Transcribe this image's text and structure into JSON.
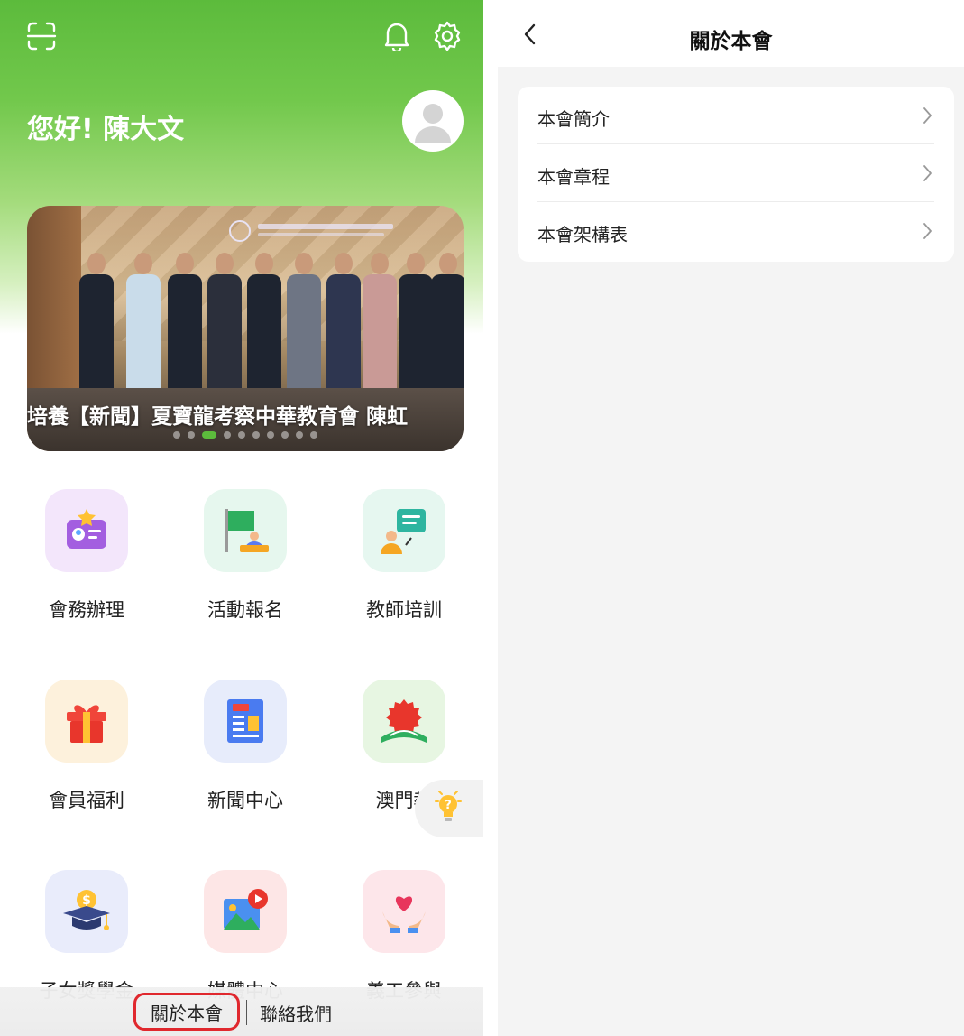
{
  "home": {
    "header": {
      "scan_icon": "scan-icon",
      "bell_icon": "bell-icon",
      "settings_icon": "gear-icon"
    },
    "greeting": "您好! 陳大文",
    "banner": {
      "caption": "培養【新聞】夏寶龍考察中華教育會 陳虹",
      "dots_total": 10,
      "active_dot": 2
    },
    "tiles": [
      {
        "label": "會務辦理",
        "icon": "member-card-icon",
        "bg": "#f3e6fb"
      },
      {
        "label": "活動報名",
        "icon": "flag-icon",
        "bg": "#e6f7ee"
      },
      {
        "label": "教師培訓",
        "icon": "teacher-icon",
        "bg": "#e6f7f0"
      },
      {
        "label": "會員福利",
        "icon": "gift-icon",
        "bg": "#fdf1dc"
      },
      {
        "label": "新聞中心",
        "icon": "news-icon",
        "bg": "#e7ecfb"
      },
      {
        "label": "澳門教",
        "icon": "education-icon",
        "bg": "#e7f6e2"
      },
      {
        "label": "子女獎學金",
        "icon": "scholarship-icon",
        "bg": "#e9ecfb"
      },
      {
        "label": "媒體中心",
        "icon": "media-icon",
        "bg": "#fde6e6"
      },
      {
        "label": "義工參與",
        "icon": "volunteer-icon",
        "bg": "#fde6ea"
      }
    ],
    "bottom_links": {
      "about": "關於本會",
      "contact": "聯絡我們"
    },
    "help_icon": "lightbulb-question-icon"
  },
  "about_page": {
    "title": "關於本會",
    "back_icon": "chevron-left-icon",
    "items": [
      {
        "label": "本會簡介"
      },
      {
        "label": "本會章程"
      },
      {
        "label": "本會架構表"
      }
    ]
  }
}
